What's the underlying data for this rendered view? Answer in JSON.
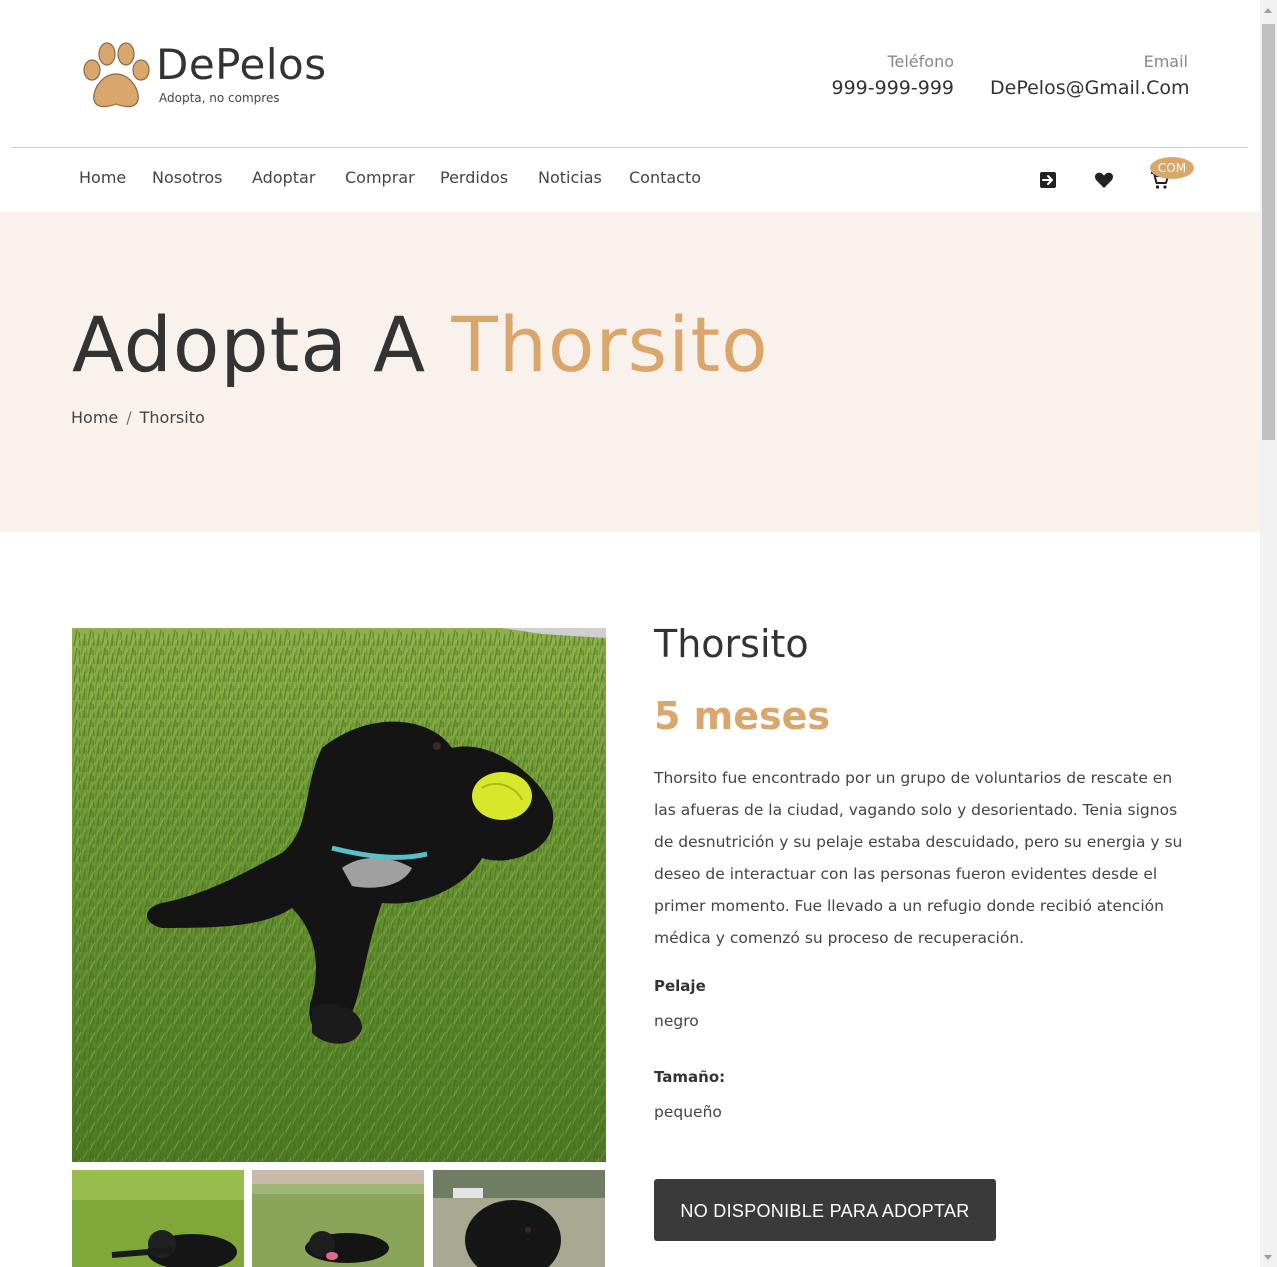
{
  "header": {
    "logo_name": "DePelos",
    "logo_tagline": "Adopta, no compres",
    "phone_label": "Teléfono",
    "phone_value": "999-999-999",
    "email_label": "Email",
    "email_value": "DePelos@Gmail.Com"
  },
  "nav": {
    "items": [
      {
        "label": "Home"
      },
      {
        "label": "Nosotros"
      },
      {
        "label": "Adoptar"
      },
      {
        "label": "Comprar"
      },
      {
        "label": "Perdidos"
      },
      {
        "label": "Noticias"
      },
      {
        "label": "Contacto"
      }
    ],
    "icons": [
      "login-icon",
      "heart-icon",
      "cart-icon"
    ],
    "cart_badge": "COM"
  },
  "hero": {
    "title_prefix": "Adopta A",
    "title_name": "Thorsito",
    "breadcrumb": [
      {
        "label": "Home"
      },
      {
        "label": "Thorsito"
      }
    ]
  },
  "pet": {
    "name": "Thorsito",
    "age": "5 meses",
    "description": "Thorsito fue encontrado por un grupo de voluntarios de rescate en las afueras de la ciudad, vagando solo y desorientado. Tenia signos de desnutrición y su pelaje estaba descuidado, pero su energia y su deseo de interactuar con las personas fueron evidentes desde el primer momento. Fue llevado a un refugio donde recibió atención médica y comenzó su proceso de recuperación.",
    "coat_label": "Pelaje",
    "coat_value": "negro",
    "size_label": "Tamaño:",
    "size_value": "pequeño",
    "button_label": "NO DISPONIBLE PARA ADOPTAR"
  },
  "colors": {
    "accent": "#d9a66b",
    "hero_bg": "#f9f1eb",
    "button_bg": "#3a3a3a"
  }
}
